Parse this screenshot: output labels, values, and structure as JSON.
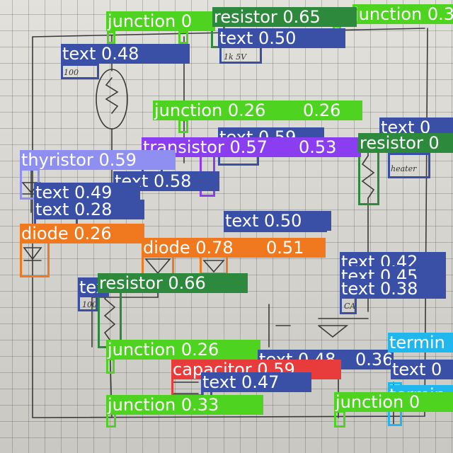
{
  "image": {
    "label_format": "{class} {score}"
  },
  "colors": {
    "text": "#3a50a6",
    "junction": "#4fd321",
    "resistor": "#2d8a3c",
    "thyristor": "#8f8ff2",
    "transistor": "#8b3df0",
    "diode": "#f0781e",
    "capacitor": "#e83c3c",
    "terminal": "#1fb7ee"
  },
  "handwriting": {
    "h1": "100",
    "h2": "1k 5V",
    "h3": "heater",
    "h4": "100",
    "h5": "CA"
  },
  "detections": [
    {
      "cls": "junction",
      "score": "0.33",
      "label": "junction 0.33"
    },
    {
      "cls": "resistor",
      "score": "0.65",
      "label": "resistor 0.65"
    },
    {
      "cls": "text",
      "score": "0.50",
      "label": "text 0.50"
    },
    {
      "cls": "junction",
      "score": "",
      "label": "junction 0"
    },
    {
      "cls": "text",
      "score": "0.48",
      "label": "text 0.48"
    },
    {
      "cls": "junction",
      "score": "0.26",
      "label": "junction 0.26"
    },
    {
      "cls": "junction",
      "score": "0.26",
      "label": "0.26"
    },
    {
      "cls": "text",
      "score": "0.59",
      "label": "text 0.59"
    },
    {
      "cls": "transistor",
      "score": "0.57",
      "label": "transistor 0.57"
    },
    {
      "cls": "transistor",
      "score": "0.53",
      "label": "0.53"
    },
    {
      "cls": "resistor",
      "score": "",
      "label": "resistor 0"
    },
    {
      "cls": "text",
      "score": "",
      "label": "text 0"
    },
    {
      "cls": "thyristor",
      "score": "0.59",
      "label": "thyristor 0.59"
    },
    {
      "cls": "text",
      "score": "0.58",
      "label": "text 0.58"
    },
    {
      "cls": "text",
      "score": "0.49",
      "label": "text 0.49"
    },
    {
      "cls": "text",
      "score": "0.28",
      "label": "text 0.28"
    },
    {
      "cls": "text",
      "score": "0.50",
      "label": "text 0.50"
    },
    {
      "cls": "diode",
      "score": "0.26",
      "label": "diode 0.26"
    },
    {
      "cls": "diode",
      "score": "0.78",
      "label": "diode 0.78"
    },
    {
      "cls": "diode",
      "score": "0.51",
      "label": "0.51"
    },
    {
      "cls": "text",
      "score": "0.42",
      "label": "text 0.42"
    },
    {
      "cls": "text",
      "score": "0.45",
      "label": "text 0.45"
    },
    {
      "cls": "text",
      "score": "0.38",
      "label": "text 0.38"
    },
    {
      "cls": "text",
      "score": "",
      "label": "text"
    },
    {
      "cls": "resistor",
      "score": "0.66",
      "label": "resistor 0.66"
    },
    {
      "cls": "junction",
      "score": "0.26",
      "label": "junction 0.26"
    },
    {
      "cls": "text",
      "score": "0.48",
      "label": "text 0.48"
    },
    {
      "cls": "text",
      "score": "0.36",
      "label": "0.36"
    },
    {
      "cls": "terminal",
      "score": "",
      "label": "termin"
    },
    {
      "cls": "capacitor",
      "score": "0.59",
      "label": "capacitor 0.59"
    },
    {
      "cls": "text",
      "score": "0.47",
      "label": "text 0.47"
    },
    {
      "cls": "text",
      "score": "",
      "label": "text 0"
    },
    {
      "cls": "terminal",
      "score": "",
      "label": "termin"
    },
    {
      "cls": "junction",
      "score": "0.33",
      "label": "junction 0.33"
    },
    {
      "cls": "junction",
      "score": "",
      "label": "junction 0"
    }
  ]
}
